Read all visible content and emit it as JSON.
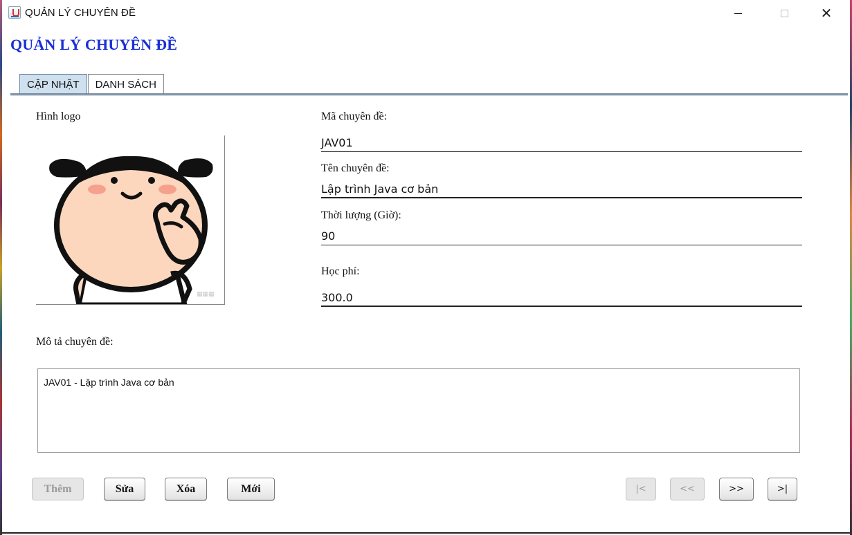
{
  "window": {
    "title": "QUẢN LÝ CHUYÊN ĐỀ",
    "icon": "java-cup-icon"
  },
  "heading": "QUẢN LÝ CHUYÊN ĐỀ",
  "tabs": [
    {
      "label": "CẬP NHẬT",
      "active": true
    },
    {
      "label": "DANH SÁCH",
      "active": false
    }
  ],
  "form": {
    "logo_label": "Hình logo",
    "ma_label": "Mã chuyên đề:",
    "ma_value": "JAV01",
    "ten_label": "Tên chuyên đề:",
    "ten_value": "Lập trình Java cơ bản",
    "thoiluong_label": "Thời lượng (Giờ):",
    "thoiluong_value": "90",
    "hocphi_label": "Học phí:",
    "hocphi_value": "300.0",
    "mota_label": "Mô tả chuyên đề:",
    "mota_value": "JAV01 - Lập trình Java cơ bản"
  },
  "buttons": {
    "them": "Thêm",
    "sua": "Sửa",
    "xoa": "Xóa",
    "moi": "Mới",
    "first": "|<",
    "prev": "<<",
    "next": ">>",
    "last": ">|"
  },
  "colors": {
    "heading": "#1a2fd6",
    "active_tab": "#cfe0ef",
    "logo_skin": "#fdd7bd",
    "logo_blush": "#f6a08e"
  }
}
